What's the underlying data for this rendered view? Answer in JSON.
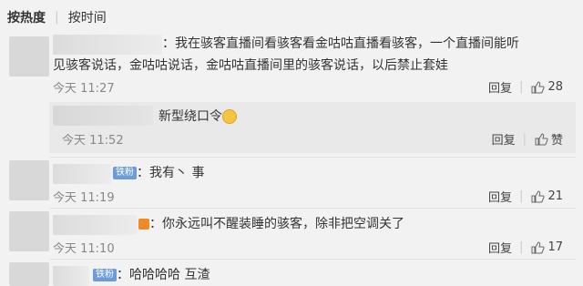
{
  "sort": {
    "hot": "按热度",
    "time": "按时间"
  },
  "comments": [
    {
      "text": "：我在骇客直播间看骇客看金咕咕直播看骇客，一个直播间能听见骇客说话，金咕咕说话，金咕咕直播间里的骇客说话，以后禁止套娃",
      "line1": "：我在骇客直播间看骇客看金咕咕直播看骇客，一个直播间能听",
      "line2": "见骇客说话，金咕咕说话，金咕咕直播间里的骇客说话，以后禁止套娃",
      "time": "今天 11:27",
      "reply": "回复",
      "likes": "28"
    },
    {
      "text": "新型绕口令",
      "time": "今天 11:52",
      "reply": "回复",
      "likes": "赞"
    },
    {
      "badge": "铁粉",
      "text": "：我有丶 事",
      "time": "今天 11:19",
      "reply": "回复",
      "likes": "21"
    },
    {
      "text": "：你永远叫不醒装睡的骇客，除非把空调关了",
      "time": "今天 11:10",
      "reply": "回复",
      "likes": "17"
    },
    {
      "badge": "铁粉",
      "text": "：哈哈哈哈 互渣"
    }
  ]
}
